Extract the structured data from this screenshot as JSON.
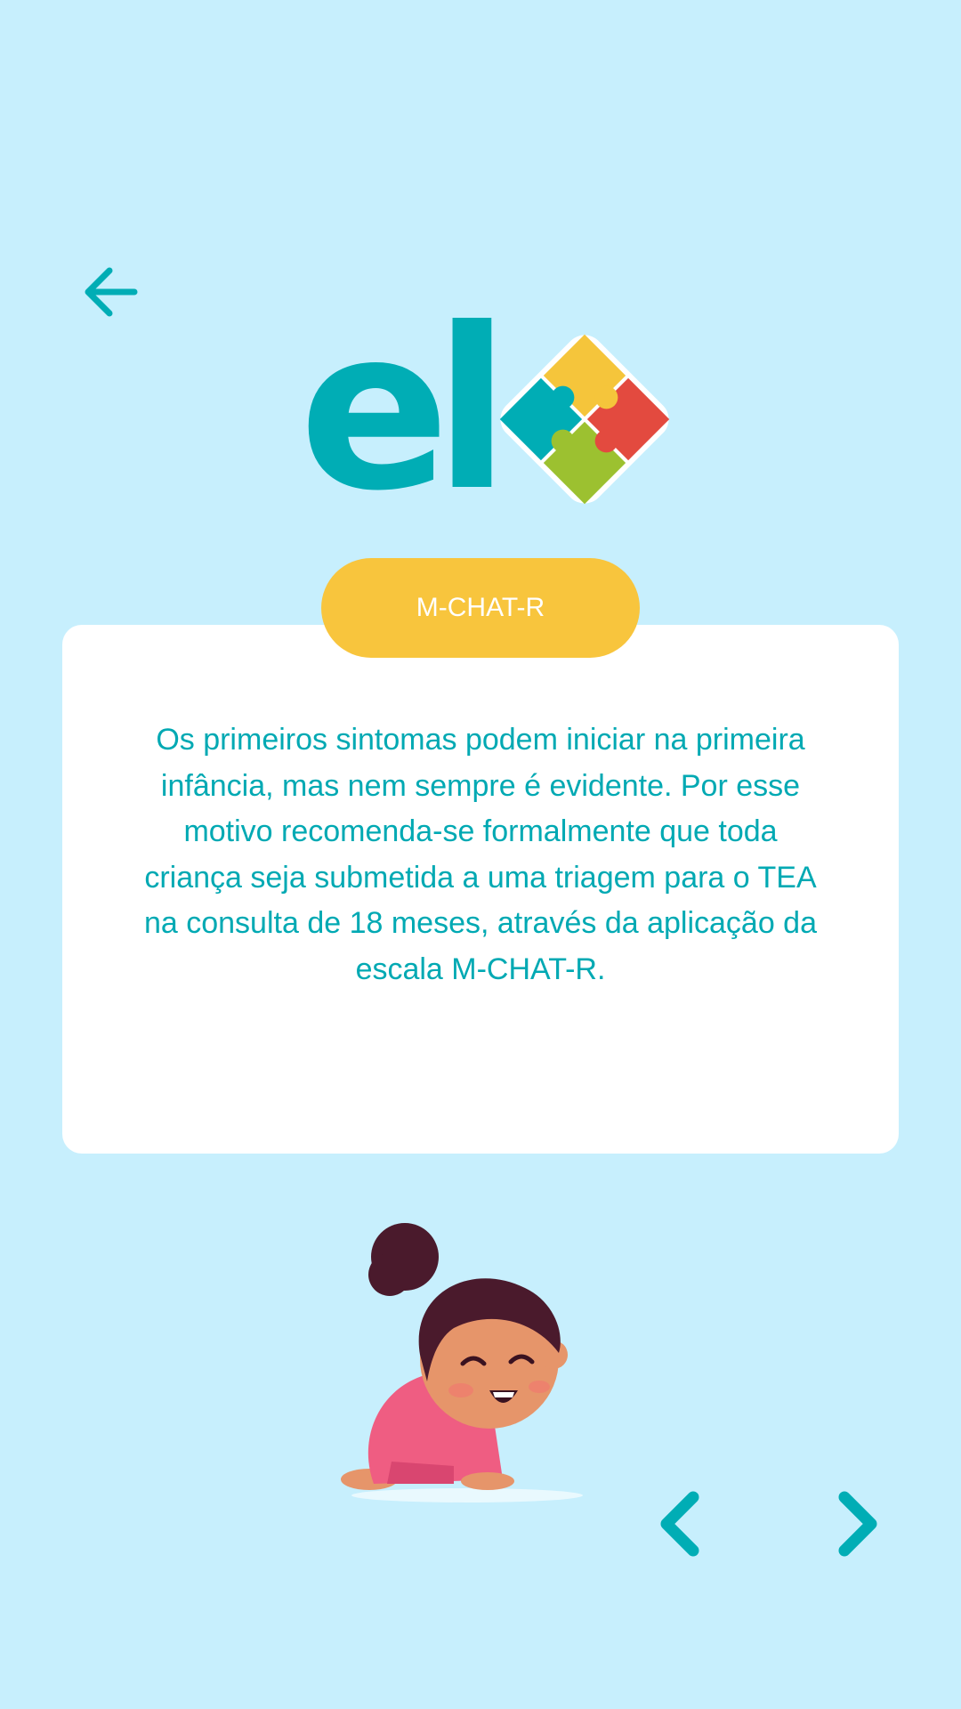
{
  "header": {
    "back_icon": "arrow-left-icon",
    "logo_text": "el",
    "logo_icon": "puzzle-pieces-icon"
  },
  "colors": {
    "background": "#c7effd",
    "accent": "#00adb5",
    "pill": "#f8c53d",
    "puzzle_yellow": "#f5c53b",
    "puzzle_red": "#e34a3f",
    "puzzle_green": "#9cc130",
    "puzzle_teal": "#00adb5"
  },
  "card": {
    "badge_label": "M-CHAT-R",
    "body_text": "Os primeiros sintomas podem iniciar na primeira infância, mas nem sempre é evidente. Por esse motivo recomenda-se formalmente que toda criança seja submetida a uma triagem para o TEA na consulta de 18 meses, através da aplicação da escala M-CHAT-R."
  },
  "illustration": {
    "icon": "crawling-baby-illustration"
  },
  "navigation": {
    "prev_icon": "chevron-left-icon",
    "next_icon": "chevron-right-icon"
  }
}
